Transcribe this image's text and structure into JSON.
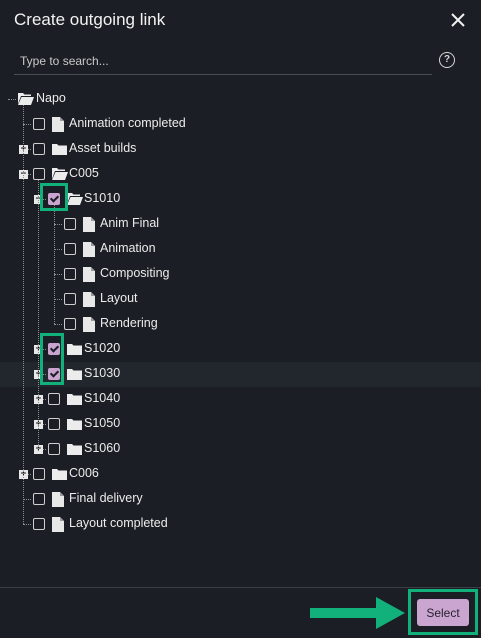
{
  "dialog": {
    "title": "Create outgoing link",
    "search_placeholder": "Type to search...",
    "help_glyph": "?",
    "select_label": "Select"
  },
  "tree": [
    {
      "label": "Napo",
      "icon": "folder-open-icon",
      "depth": 0,
      "checkbox": false,
      "expander": "",
      "checked": false
    },
    {
      "label": "Animation completed",
      "icon": "file-icon",
      "depth": 1,
      "checkbox": true,
      "expander": "",
      "checked": false
    },
    {
      "label": "Asset builds",
      "icon": "folder-icon",
      "depth": 1,
      "checkbox": true,
      "expander": "+",
      "checked": false
    },
    {
      "label": "C005",
      "icon": "folder-open-icon",
      "depth": 1,
      "checkbox": true,
      "expander": "−",
      "checked": false
    },
    {
      "label": "S1010",
      "icon": "folder-open-icon",
      "depth": 2,
      "checkbox": true,
      "expander": "−",
      "checked": true
    },
    {
      "label": "Anim Final",
      "icon": "file-icon",
      "depth": 3,
      "checkbox": true,
      "expander": "",
      "checked": false
    },
    {
      "label": "Animation",
      "icon": "file-icon",
      "depth": 3,
      "checkbox": true,
      "expander": "",
      "checked": false
    },
    {
      "label": "Compositing",
      "icon": "file-icon",
      "depth": 3,
      "checkbox": true,
      "expander": "",
      "checked": false
    },
    {
      "label": "Layout",
      "icon": "file-icon",
      "depth": 3,
      "checkbox": true,
      "expander": "",
      "checked": false
    },
    {
      "label": "Rendering",
      "icon": "file-icon",
      "depth": 3,
      "checkbox": true,
      "expander": "",
      "checked": false
    },
    {
      "label": "S1020",
      "icon": "folder-icon",
      "depth": 2,
      "checkbox": true,
      "expander": "+",
      "checked": true
    },
    {
      "label": "S1030",
      "icon": "folder-icon",
      "depth": 2,
      "checkbox": true,
      "expander": "+",
      "checked": true
    },
    {
      "label": "S1040",
      "icon": "folder-icon",
      "depth": 2,
      "checkbox": true,
      "expander": "+",
      "checked": false
    },
    {
      "label": "S1050",
      "icon": "folder-icon",
      "depth": 2,
      "checkbox": true,
      "expander": "+",
      "checked": false
    },
    {
      "label": "S1060",
      "icon": "folder-icon",
      "depth": 2,
      "checkbox": true,
      "expander": "+",
      "checked": false
    },
    {
      "label": "C006",
      "icon": "folder-icon",
      "depth": 1,
      "checkbox": true,
      "expander": "+",
      "checked": false
    },
    {
      "label": "Final delivery",
      "icon": "file-icon",
      "depth": 1,
      "checkbox": true,
      "expander": "",
      "checked": false
    },
    {
      "label": "Layout completed",
      "icon": "file-icon",
      "depth": 1,
      "checkbox": true,
      "expander": "",
      "checked": false
    }
  ],
  "colors": {
    "accent": "#c9a5cf",
    "highlight": "#12b07a",
    "background": "#1b1e24"
  }
}
